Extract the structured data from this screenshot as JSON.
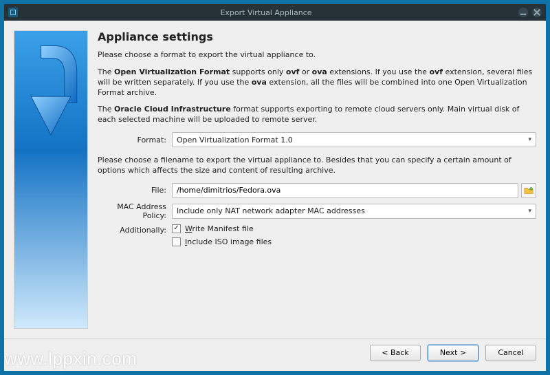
{
  "window": {
    "title": "Export Virtual Appliance",
    "minimize_icon": "minimize-icon",
    "close_icon": "close-icon"
  },
  "heading": "Appliance settings",
  "paragraphs": {
    "intro": "Please choose a format to export the virtual appliance to.",
    "ovf_pre": "The ",
    "ovf_b1": "Open Virtualization Format",
    "ovf_mid1": " supports only ",
    "ovf_b2": "ovf",
    "ovf_mid2": " or ",
    "ovf_b3": "ova",
    "ovf_mid3": " extensions. If you use the ",
    "ovf_b4": "ovf",
    "ovf_mid4": " extension, several files will be written separately. If you use the ",
    "ovf_b5": "ova",
    "ovf_tail": " extension, all the files will be combined into one Open Virtualization Format archive.",
    "oci_pre": "The ",
    "oci_b": "Oracle Cloud Infrastructure",
    "oci_tail": " format supports exporting to remote cloud servers only. Main virtual disk of each selected machine will be uploaded to remote server.",
    "filename_hint": "Please choose a filename to export the virtual appliance to. Besides that you can specify a certain amount of options which affects the size and content of resulting archive."
  },
  "labels": {
    "format": "Format:",
    "file": "File:",
    "mac": "MAC Address Policy:",
    "additionally": "Additionally:"
  },
  "values": {
    "format_selected": "Open Virtualization Format 1.0",
    "file_path": "/home/dimitrios/Fedora.ova",
    "mac_selected": "Include only NAT network adapter MAC addresses"
  },
  "checks": {
    "write_manifest_checked": true,
    "write_manifest_u": "W",
    "write_manifest_rest": "rite Manifest file",
    "include_iso_checked": false,
    "include_iso_u": "I",
    "include_iso_rest": "nclude ISO image files"
  },
  "buttons": {
    "back": "< Back",
    "next": "Next >",
    "cancel": "Cancel"
  },
  "watermark": "www.lppxin.com"
}
